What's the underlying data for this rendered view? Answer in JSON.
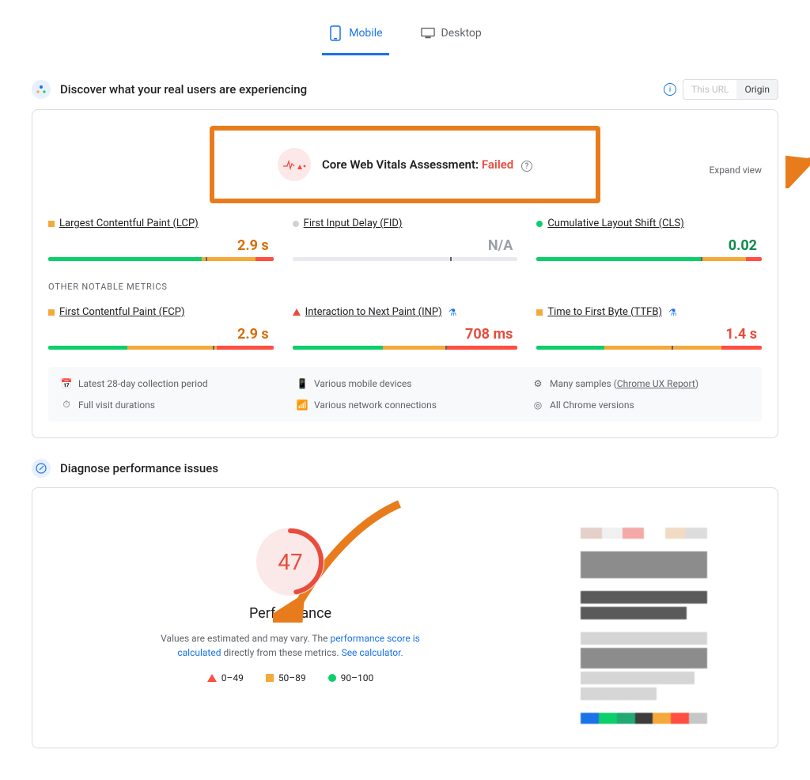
{
  "tabs": {
    "mobile": "Mobile",
    "desktop": "Desktop"
  },
  "sections": {
    "discover": "Discover what your real users are experiencing",
    "diagnose": "Diagnose performance issues"
  },
  "toggles": {
    "this_url": "This URL",
    "origin": "Origin"
  },
  "cwv": {
    "label": "Core Web Vitals Assessment: ",
    "status": "Failed",
    "expand": "Expand view"
  },
  "metrics": {
    "lcp": {
      "name": "Largest Contentful Paint (LCP)",
      "value": "2.9 s"
    },
    "fid": {
      "name": "First Input Delay (FID)",
      "value": "N/A"
    },
    "cls": {
      "name": "Cumulative Layout Shift (CLS)",
      "value": "0.02"
    }
  },
  "other_label": "OTHER NOTABLE METRICS",
  "other": {
    "fcp": {
      "name": "First Contentful Paint (FCP)",
      "value": "2.9 s"
    },
    "inp": {
      "name": "Interaction to Next Paint (INP)",
      "value": "708 ms"
    },
    "ttfb": {
      "name": "Time to First Byte (TTFB)",
      "value": "1.4 s"
    }
  },
  "footer": {
    "period": "Latest 28-day collection period",
    "devices": "Various mobile devices",
    "samples_prefix": "Many samples (",
    "samples_link": "Chrome UX Report",
    "samples_suffix": ")",
    "durations": "Full visit durations",
    "networks": "Various network connections",
    "versions": "All Chrome versions"
  },
  "perf": {
    "score": "47",
    "label": "Performance",
    "desc_1": "Values are estimated and may vary. The ",
    "desc_link1": "performance score is calculated",
    "desc_2": " directly from these metrics. ",
    "desc_link2": "See calculator.",
    "legend": {
      "low": "0–49",
      "mid": "50–89",
      "high": "90–100"
    }
  }
}
